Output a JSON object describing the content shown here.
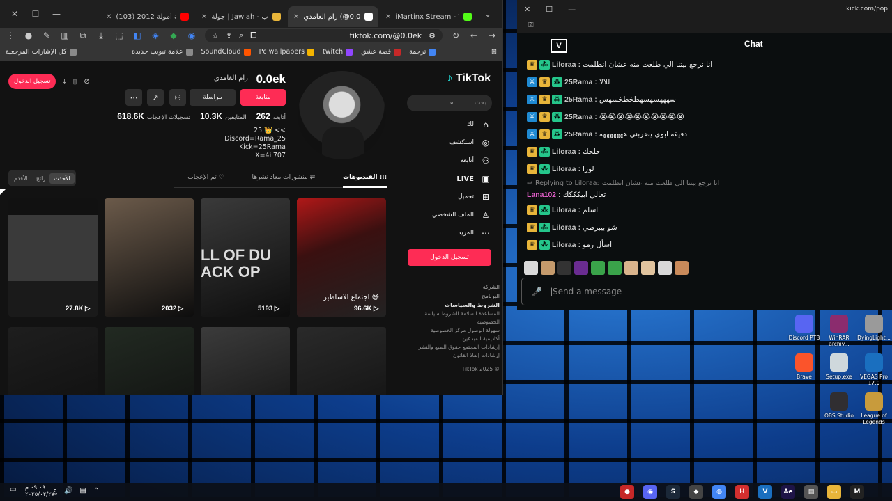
{
  "browser": {
    "window_controls": [
      "✕",
      "☐",
      "—"
    ],
    "tabs": [
      {
        "label": "iMartinx Stream - Watch Liv",
        "active": false
      },
      {
        "label": "رام الغامدي (@0.0ek) | Tok",
        "active": true
      },
      {
        "label": "جولة | Jawlah - منصة الألعاب",
        "active": false
      },
      {
        "label": "(103) مقدمة أمولة 2012 -",
        "active": false
      }
    ],
    "url": "tiktok.com/@0.0ek",
    "bookmarks": [
      {
        "label": "كل الإشارات المرجعية",
        "color": "#8a8a8a"
      },
      {
        "label": "علامة تبويب جديدة",
        "color": "#8a8a8a"
      },
      {
        "label": "SoundCloud",
        "color": "#ff5500"
      },
      {
        "label": "Pc wallpapers",
        "color": "#f4b400"
      },
      {
        "label": "twitch",
        "color": "#9146ff"
      },
      {
        "label": "قصة عشق",
        "color": "#c62828"
      },
      {
        "label": "ترجمة",
        "color": "#4285f4"
      }
    ]
  },
  "tiktok": {
    "logo": "TikTok",
    "search_placeholder": "بحث",
    "nav": [
      {
        "label": "لك",
        "icon": "home-icon",
        "glyph": "⌂"
      },
      {
        "label": "استكشف",
        "icon": "compass-icon",
        "glyph": "◎"
      },
      {
        "label": "أتابعه",
        "icon": "following-icon",
        "glyph": "⚇"
      },
      {
        "label": "LIVE",
        "icon": "live-icon",
        "glyph": "▣"
      },
      {
        "label": "تحميل",
        "icon": "upload-icon",
        "glyph": "⊞"
      },
      {
        "label": "الملف الشخصي",
        "icon": "profile-icon",
        "glyph": "♙"
      },
      {
        "label": "المزيد",
        "icon": "more-icon",
        "glyph": "⋯"
      }
    ],
    "login_button": "تسجيل الدخول",
    "top_login": "تسجيل الدخول",
    "footer": {
      "company": "الشركة",
      "program": "البرنامج",
      "terms_heading": "الشروط والسياسات",
      "links": [
        "المساعدة السلامة الشروط سياسة الخصوصية",
        "سهولة الوصول مركز الخصوصية أكاديمية المبدعين",
        "إرشادات المجتمع حقوق الطبع والنشر",
        "إرشادات إنفاذ القانون"
      ],
      "copyright": "TikTok 2025 ©"
    },
    "profile": {
      "username": "0.0ek",
      "nickname": "رام الغامدي",
      "follow": "متابعة",
      "message": "مراسلة",
      "stats": [
        {
          "value": "618.6K",
          "label": "تسجيلات الإعجاب"
        },
        {
          "value": "10.3K",
          "label": "المتابعين"
        },
        {
          "value": "262",
          "label": "أتابعه"
        }
      ],
      "bio": [
        "25 👑 <<",
        "Discord=Rama_25",
        "Kick=25Rama",
        "X=4il707"
      ]
    },
    "tabs": [
      {
        "label": "الفيديوهات",
        "active": true
      },
      {
        "label": "منشورات معاد نشرها",
        "active": false
      },
      {
        "label": "تم الإعجاب",
        "active": false
      }
    ],
    "sort": [
      {
        "label": "الأحدث",
        "active": true
      },
      {
        "label": "رائج",
        "active": false
      },
      {
        "label": "الأقدم",
        "active": false
      }
    ],
    "videos": [
      {
        "count": "96.6K",
        "caption": "اجتماع الاساطير 😅",
        "color": "#5a1a1a"
      },
      {
        "count": "5193",
        "caption": "",
        "color": "#3a3a3a"
      },
      {
        "count": "2032",
        "caption": "",
        "color": "#6b5a4a"
      },
      {
        "count": "27.8K",
        "caption": "",
        "color": "#2c2c2c"
      },
      {
        "count": "",
        "caption": "",
        "color": "#2a2a2a"
      },
      {
        "count": "",
        "caption": "",
        "color": "#3b3b3b"
      },
      {
        "count": "",
        "caption": "",
        "color": "#222a22"
      },
      {
        "count": "",
        "caption": "",
        "color": "#1e1e1e"
      }
    ]
  },
  "chat": {
    "window_title_url": "kick.com/pop",
    "title": "Chat",
    "logo": "V",
    "messages": [
      {
        "user": "Liloraa",
        "text": "انا نرجع بيتنا الي طلعت منه عشان انطلمت",
        "color": "#c7c7c7",
        "badges": [
          "crown",
          "green"
        ]
      },
      {
        "user": "25Rama",
        "text": "للالا",
        "color": "#c7c7c7",
        "badges": [
          "sword",
          "crown",
          "green"
        ]
      },
      {
        "user": "25Rama",
        "text": "سهههسهسهطخطخسهس",
        "color": "#c7c7c7",
        "badges": [
          "sword",
          "crown",
          "green"
        ]
      },
      {
        "user": "25Rama",
        "text": "😭😭😭😭😭😭😭😭😭😭",
        "color": "#c7c7c7",
        "badges": [
          "sword",
          "crown",
          "green"
        ]
      },
      {
        "user": "25Rama",
        "text": "دقيقه ابوي يضربني هههههههه",
        "color": "#c7c7c7",
        "badges": [
          "sword",
          "crown",
          "green"
        ]
      },
      {
        "user": "Liloraa",
        "text": "حلحك",
        "color": "#c7c7c7",
        "badges": [
          "crown",
          "green"
        ]
      },
      {
        "user": "Liloraa",
        "text": "لورا",
        "color": "#c7c7c7",
        "badges": [
          "crown",
          "green"
        ]
      }
    ],
    "reply": {
      "prefix": "Replying to Liloraa:",
      "text": "انا نرجع بيتنا الي طلعت منه عشان انطلمت"
    },
    "reply_message": {
      "user": "Lana102",
      "text": "تعالي ابيكككك",
      "color": "#e05ec7"
    },
    "messages2": [
      {
        "user": "Liloraa",
        "text": "اسلم",
        "color": "#c7c7c7",
        "badges": [
          "crown",
          "green"
        ]
      },
      {
        "user": "Liloraa",
        "text": "شو بيبرطي",
        "color": "#c7c7c7",
        "badges": [
          "crown",
          "green"
        ]
      },
      {
        "user": "Liloraa",
        "text": "اسأل رمو",
        "color": "#c7c7c7",
        "badges": [
          "crown",
          "green"
        ]
      }
    ],
    "input_placeholder": "Send a message"
  },
  "desktop_icons": [
    {
      "label": "Discord PTB",
      "color": "#5865f2"
    },
    {
      "label": "WinRAR archiv...",
      "color": "#8b2c6e"
    },
    {
      "label": "DyingLight...",
      "color": "#9a9a9a"
    },
    {
      "label": "Brave",
      "color": "#fb542b"
    },
    {
      "label": "Setup.exe",
      "color": "#cfd8dc"
    },
    {
      "label": "VEGAS Pro 17.0",
      "color": "#1a6fbf"
    },
    {
      "label": "OBS Studio",
      "color": "#302e31"
    },
    {
      "label": "League of Legends",
      "color": "#c89b3c"
    }
  ],
  "taskbar": {
    "time": "٠٩:٠٩ م",
    "date": "٢٠٢٥/٠٣/٢٧",
    "lang": "ع",
    "apps": [
      {
        "name": "app-red",
        "color": "#c62828",
        "glyph": "●"
      },
      {
        "name": "app-purple",
        "color": "#5865f2",
        "glyph": "◉"
      },
      {
        "name": "steam",
        "color": "#1b2838",
        "glyph": "S"
      },
      {
        "name": "app-game",
        "color": "#444",
        "glyph": "◆"
      },
      {
        "name": "chrome",
        "color": "#4285f4",
        "glyph": "◍"
      },
      {
        "name": "app-h",
        "color": "#d32f2f",
        "glyph": "H"
      },
      {
        "name": "vegas",
        "color": "#1a6fbf",
        "glyph": "V"
      },
      {
        "name": "after-effects",
        "color": "#1e1447",
        "glyph": "Ae"
      },
      {
        "name": "app-files",
        "color": "#555",
        "glyph": "▤"
      },
      {
        "name": "explorer",
        "color": "#e8b53a",
        "glyph": "▭"
      },
      {
        "name": "app-m",
        "color": "#222",
        "glyph": "M"
      }
    ]
  }
}
